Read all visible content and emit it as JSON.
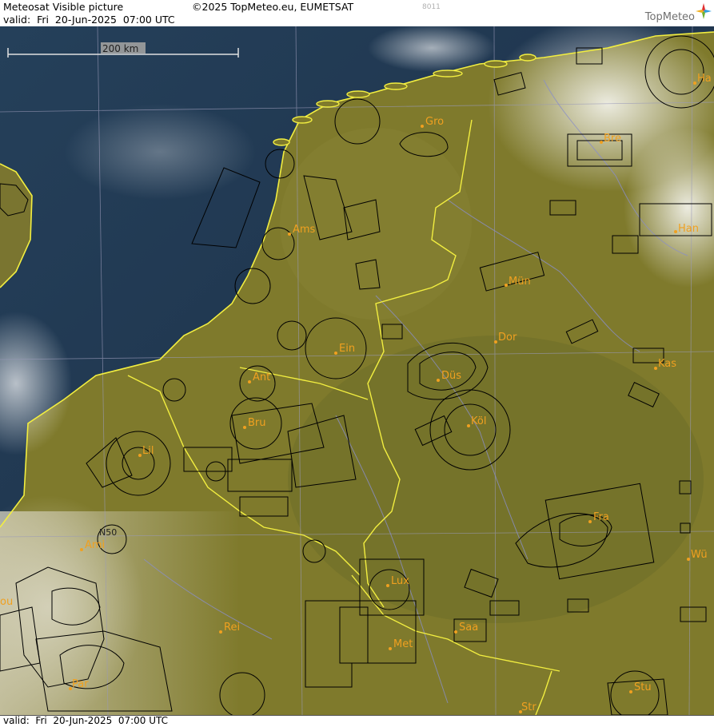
{
  "header": {
    "title": "Meteosat Visible picture",
    "copyright": "©2025 TopMeteo.eu, EUMETSAT",
    "valid": "valid:  Fri  20-Jun-2025  07:00 UTC",
    "code": "8011",
    "brand": "TopMeteo"
  },
  "footer": {
    "valid": "valid:  Fri  20-Jun-2025  07:00 UTC"
  },
  "scale": {
    "label": "200 km"
  },
  "cities": {
    "gro": "Gro",
    "ams": "Ams",
    "ein": "Ein",
    "ant": "Ant",
    "bru": "Bru",
    "lil": "Lil",
    "ami": "Ami",
    "rei": "Rei",
    "par": "Par",
    "lux": "Lux",
    "met": "Met",
    "saa": "Saa",
    "str": "Str",
    "stu": "Stu",
    "fra": "Fra",
    "wue": "Wü",
    "kas": "Kas",
    "koe": "Köl",
    "due": "Düs",
    "dor": "Dor",
    "mue": "Mün",
    "han": "Han",
    "bre": "Bre",
    "ham": "Ha",
    "ou": "ou",
    "nso": "N50"
  },
  "colors": {
    "sea": "#1c3148",
    "land": "#7f7a2c",
    "coast": "#f2ee40",
    "border": "#f2ee40",
    "airspace": "#000000",
    "grid": "#9a9ab8",
    "city": "#f0a020"
  }
}
